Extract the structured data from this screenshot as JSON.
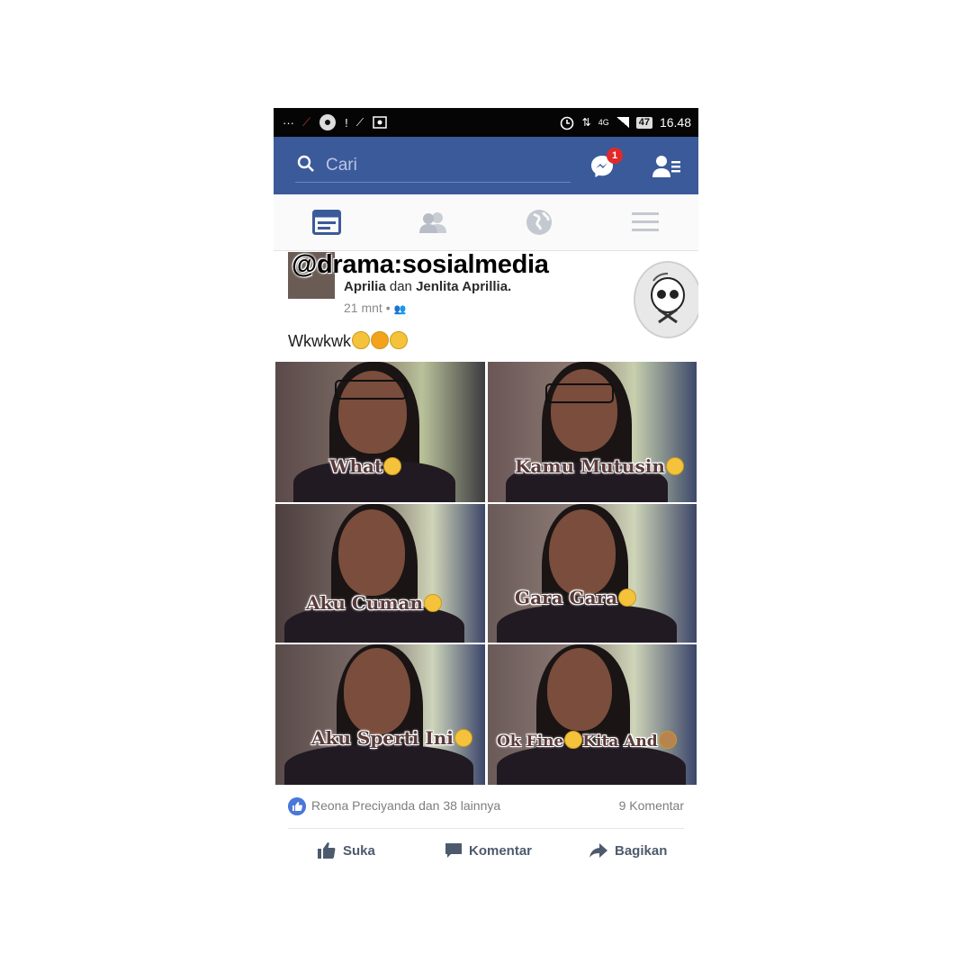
{
  "watermark": "@drama:sosialmedia",
  "status_bar": {
    "time": "16.48",
    "battery": "47",
    "network": "4G",
    "colors": {
      "background": "#050505",
      "text": "#ffffff"
    }
  },
  "fb_header": {
    "search_placeholder": "Cari",
    "messenger_badge": "1",
    "colors": {
      "background": "#3b5a9a",
      "badge": "#e02a2a"
    }
  },
  "tabs": [
    {
      "icon": "news-feed-icon",
      "active": true
    },
    {
      "icon": "friends-icon",
      "active": false
    },
    {
      "icon": "globe-icon",
      "active": false
    },
    {
      "icon": "menu-icon",
      "active": false
    }
  ],
  "post": {
    "names_first": "Aprilia",
    "names_joiner": "dan",
    "names_second": "Jenlita Aprillia.",
    "time": "21 mnt",
    "text": "Wkwkwk",
    "photos": [
      {
        "caption": "What"
      },
      {
        "caption": "Kamu Mutusin"
      },
      {
        "caption": "Aku  Cuman"
      },
      {
        "caption": "Gara Gara"
      },
      {
        "caption": "Aku Sperti Ini"
      },
      {
        "caption": "Ok Fine",
        "caption_b": "Kita And"
      }
    ],
    "reactions": "Reona Preciyanda dan 38 lainnya",
    "comments": "9 Komentar"
  },
  "actions": {
    "like": "Suka",
    "comment": "Komentar",
    "share": "Bagikan"
  }
}
